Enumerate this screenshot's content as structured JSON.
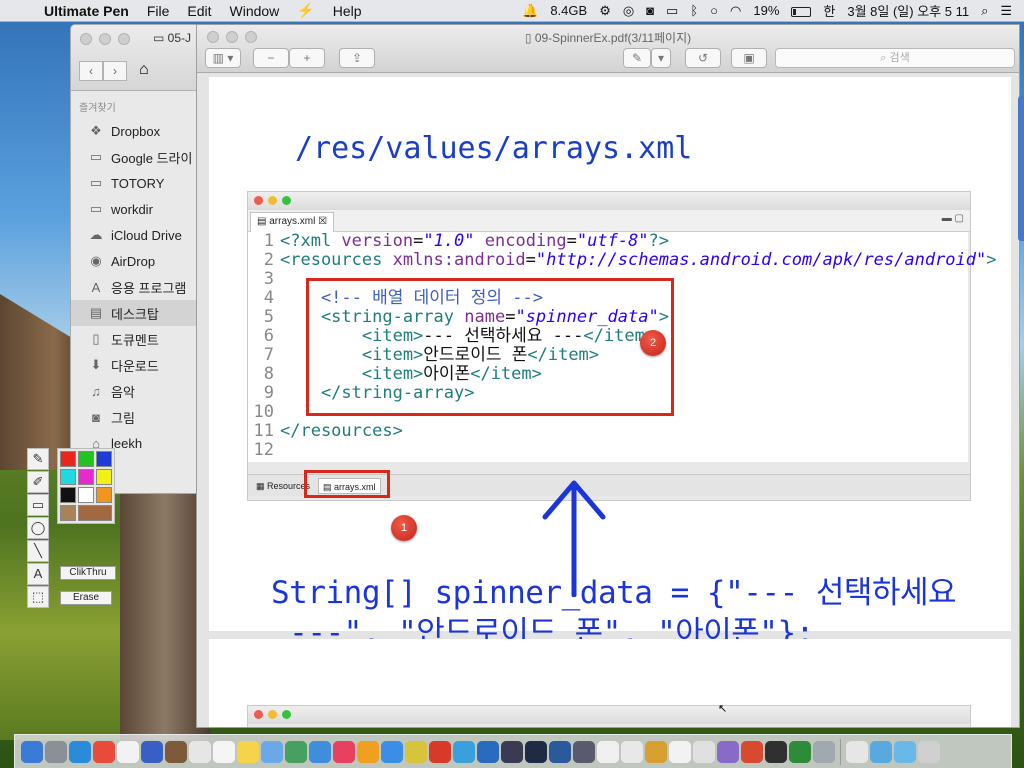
{
  "menubar": {
    "app_name": "Ultimate Pen",
    "menus": [
      "File",
      "Edit",
      "Window",
      "Help"
    ],
    "memory": "8.4GB",
    "battery_pct": "19%",
    "battery_level": 0.19,
    "clock": "3월 8일 (일) 오후 5 11"
  },
  "finder": {
    "title": "05-J",
    "section_label": "즐겨찾기",
    "items": [
      {
        "label": "Dropbox",
        "icon": "dropbox-icon"
      },
      {
        "label": "Google 드라이",
        "icon": "folder-icon"
      },
      {
        "label": "TOTORY",
        "icon": "folder-icon"
      },
      {
        "label": "workdir",
        "icon": "folder-icon"
      },
      {
        "label": "iCloud Drive",
        "icon": "cloud-icon"
      },
      {
        "label": "AirDrop",
        "icon": "airdrop-icon"
      },
      {
        "label": "응용 프로그램",
        "icon": "applications-icon"
      },
      {
        "label": "데스크탑",
        "icon": "desktop-icon",
        "selected": true
      },
      {
        "label": "도큐멘트",
        "icon": "document-icon"
      },
      {
        "label": "다운로드",
        "icon": "download-icon"
      },
      {
        "label": "음악",
        "icon": "music-icon"
      },
      {
        "label": "그림",
        "icon": "camera-icon"
      },
      {
        "label": "leekh",
        "icon": "home-icon"
      }
    ]
  },
  "preview": {
    "title": "09-SpinnerEx.pdf(3/11페이지)",
    "search_placeholder": "검색"
  },
  "slide": {
    "heading": "/res/values/arrays.xml",
    "editor_tab": "arrays.xml",
    "bottom_tabs": [
      "Resources",
      "arrays.xml"
    ],
    "code_lines": [
      {
        "n": "1",
        "segments": [
          {
            "c": "tag",
            "t": "<?xml "
          },
          {
            "c": "attr",
            "t": "version"
          },
          {
            "c": "txt",
            "t": "="
          },
          {
            "c": "val",
            "t": "\"1.0\""
          },
          {
            "c": "attr",
            "t": " encoding"
          },
          {
            "c": "txt",
            "t": "="
          },
          {
            "c": "val",
            "t": "\"utf-8\""
          },
          {
            "c": "tag",
            "t": "?>"
          }
        ]
      },
      {
        "n": "2",
        "segments": [
          {
            "c": "tag",
            "t": "<resources "
          },
          {
            "c": "attr",
            "t": "xmlns:android"
          },
          {
            "c": "txt",
            "t": "="
          },
          {
            "c": "val",
            "t": "\"http://schemas.android.com/apk/res/android\""
          },
          {
            "c": "tag",
            "t": ">"
          }
        ]
      },
      {
        "n": "3",
        "segments": []
      },
      {
        "n": "4",
        "segments": [
          {
            "c": "cmt",
            "t": "    <!-- 배열 데이터 정의 -->"
          }
        ]
      },
      {
        "n": "5",
        "segments": [
          {
            "c": "tag",
            "t": "    <string-array "
          },
          {
            "c": "attr",
            "t": "name"
          },
          {
            "c": "txt",
            "t": "="
          },
          {
            "c": "val",
            "t": "\"spinner_data\""
          },
          {
            "c": "tag",
            "t": ">"
          }
        ]
      },
      {
        "n": "6",
        "segments": [
          {
            "c": "tag",
            "t": "        <item>"
          },
          {
            "c": "txt",
            "t": "--- 선택하세요 ---"
          },
          {
            "c": "tag",
            "t": "</item>"
          }
        ]
      },
      {
        "n": "7",
        "segments": [
          {
            "c": "tag",
            "t": "        <item>"
          },
          {
            "c": "txt",
            "t": "안드로이드 폰"
          },
          {
            "c": "tag",
            "t": "</item>"
          }
        ]
      },
      {
        "n": "8",
        "segments": [
          {
            "c": "tag",
            "t": "        <item>"
          },
          {
            "c": "txt",
            "t": "아이폰"
          },
          {
            "c": "tag",
            "t": "</item>"
          }
        ]
      },
      {
        "n": "9",
        "segments": [
          {
            "c": "tag",
            "t": "    </string-array>"
          }
        ]
      },
      {
        "n": "10",
        "segments": []
      },
      {
        "n": "11",
        "segments": [
          {
            "c": "tag",
            "t": "</resources>"
          }
        ]
      },
      {
        "n": "12",
        "segments": []
      }
    ],
    "badge_1": "1",
    "badge_2": "2",
    "annotation_line_1": "String[] spinner_data = {\"--- 선택하세요",
    "annotation_line_2": " ---\", \"안드로이드 폰\", \"아이폰\"};"
  },
  "pen_palette": {
    "colors": [
      "#e8261c",
      "#22c31e",
      "#1e3bd8",
      "#22d8e0",
      "#e62ad0",
      "#f2f016",
      "#111111",
      "#ffffff",
      "#f0961e",
      "#a9825a",
      "#a06a3e"
    ],
    "clickthru_label": "ClikThru",
    "erase_label": "Erase"
  },
  "dock_colors": [
    "#3a7bd5",
    "#8a8f98",
    "#2a8cd8",
    "#e84a3c",
    "#f2f2f2",
    "#3a5fc4",
    "#7c5a3a",
    "#e6e6e6",
    "#f5f5f5",
    "#f6d34a",
    "#6aa8e8",
    "#48a060",
    "#3e8edc",
    "#e84060",
    "#f0a020",
    "#3a8ee6",
    "#d8c43a",
    "#d83a2a",
    "#3aa0dc",
    "#2a6bc0",
    "#3a3a52",
    "#1f2a44",
    "#2b5a9c",
    "#5a5a6e",
    "#f0f0f0",
    "#e8e8e8",
    "#d8a030",
    "#f2f2f2",
    "#e0e0e0",
    "#8a6ac8",
    "#d84a30",
    "#303030",
    "#2e8b3a",
    "#a0a8b0",
    "#e6e6e6",
    "#5aa8e0",
    "#6ab8e8",
    "#d0d0d0"
  ]
}
